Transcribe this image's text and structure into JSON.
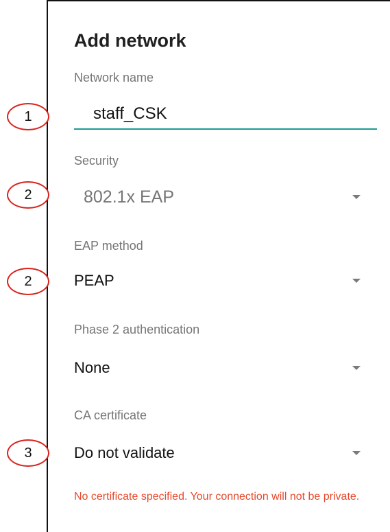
{
  "dialog": {
    "title": "Add network",
    "network_name": {
      "label": "Network name",
      "value": "staff_CSK"
    },
    "security": {
      "label": "Security",
      "value": "802.1x EAP"
    },
    "eap_method": {
      "label": "EAP method",
      "value": "PEAP"
    },
    "phase2": {
      "label": "Phase 2 authentication",
      "value": "None"
    },
    "ca_certificate": {
      "label": "CA certificate",
      "value": "Do not validate"
    },
    "warning": "No certificate specified. Your connection will not be private."
  },
  "callouts": {
    "network_name": "1",
    "security": "2",
    "eap_method": "2",
    "ca_certificate": "3"
  },
  "colors": {
    "accent": "#1a9a94",
    "error": "#e6482b",
    "callout_ring": "#d9231d"
  },
  "icons": {
    "dropdown": "caret-down-icon"
  }
}
